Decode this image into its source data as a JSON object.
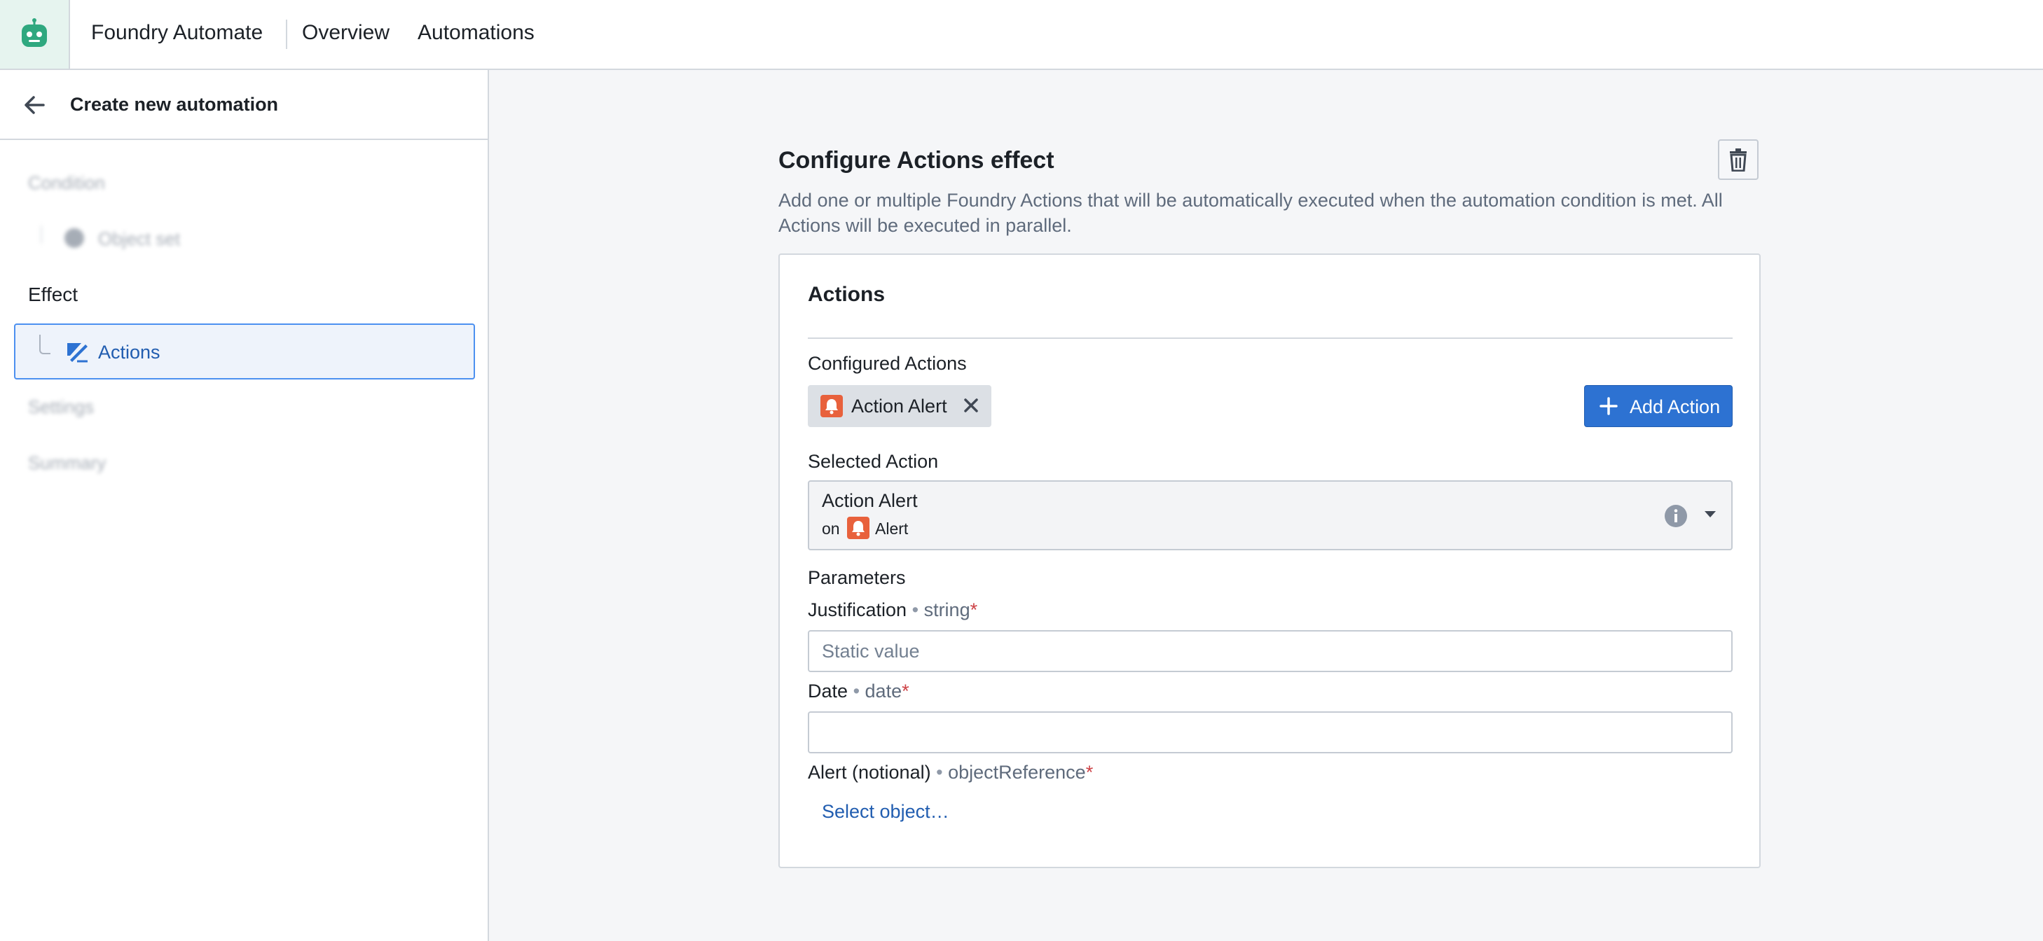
{
  "topbar": {
    "app_name": "Foundry Automate",
    "nav": {
      "overview": "Overview",
      "automations": "Automations"
    },
    "logo_icon": "robot-icon"
  },
  "sidebar": {
    "title": "Create new automation",
    "back_icon": "arrow-left-icon",
    "steps": {
      "condition": "Condition",
      "object_set": "Object set",
      "effect": "Effect",
      "actions": "Actions",
      "settings": "Settings",
      "summary": "Summary"
    }
  },
  "main": {
    "title": "Configure Actions effect",
    "description": "Add one or multiple Foundry Actions that will be automatically executed when the automation condition is met. All Actions will be executed in parallel.",
    "card": {
      "title": "Actions",
      "configured_label": "Configured Actions",
      "configured_actions": [
        {
          "label": "Action Alert",
          "icon": "bell-icon"
        }
      ],
      "add_button": "Add Action",
      "selected_label": "Selected Action",
      "selected": {
        "name": "Action Alert",
        "on": "on",
        "object": "Alert"
      },
      "parameters_label": "Parameters",
      "parameters": [
        {
          "name": "Justification",
          "sep": "•",
          "type": "string",
          "required": "*",
          "placeholder": "Static value",
          "value": ""
        },
        {
          "name": "Date",
          "sep": "•",
          "type": "date",
          "required": "*",
          "placeholder": "",
          "value": ""
        },
        {
          "name": "Alert (notional)",
          "sep": "•",
          "type": "objectReference",
          "required": "*",
          "link": "Select object…"
        }
      ]
    }
  },
  "colors": {
    "accent": "#2d72d2",
    "link": "#215db0",
    "alert_icon": "#e8613c",
    "logo_bg": "#e6f4ef",
    "logo_fg": "#2fa87f",
    "required": "#cd4246"
  }
}
